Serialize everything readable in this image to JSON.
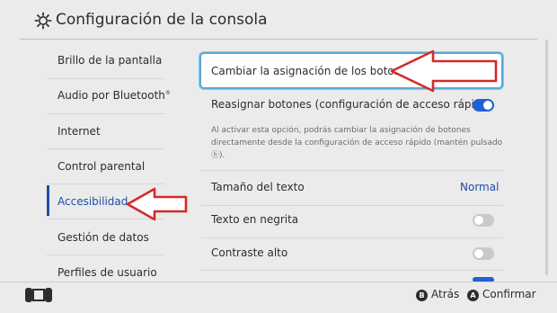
{
  "header": {
    "title": "Configuración de la consola"
  },
  "sidebar": {
    "items": [
      {
        "label": "Brillo de la pantalla"
      },
      {
        "label": "Audio por Bluetooth"
      },
      {
        "label": "Internet"
      },
      {
        "label": "Control parental"
      },
      {
        "label": "Accesibilidad",
        "active": true
      },
      {
        "label": "Gestión de datos"
      },
      {
        "label": "Perfiles de usuario"
      }
    ],
    "bluetooth_mark": "®"
  },
  "main": {
    "remap_button": "Cambiar la asignación de los botones",
    "remap_quick": {
      "label": "Reasignar botones (configuración de acceso rápido)",
      "state": "on"
    },
    "remap_desc": "Al activar esta opción, podrás cambiar la asignación de botones directamente desde la configuración de acceso rápido (mantén pulsado ⓗ).",
    "text_size": {
      "label": "Tamaño del texto",
      "value": "Normal"
    },
    "bold_text": {
      "label": "Texto en negrita",
      "state": "off"
    },
    "high_contrast": {
      "label": "Contraste alto",
      "state": "off"
    }
  },
  "footer": {
    "back_key": "B",
    "back_label": "Atrás",
    "confirm_key": "A",
    "confirm_label": "Confirmar"
  },
  "colors": {
    "accent": "#1f4ea8",
    "toggle_on": "#1f60d6",
    "annotation_arrow": "#d42a2a"
  }
}
